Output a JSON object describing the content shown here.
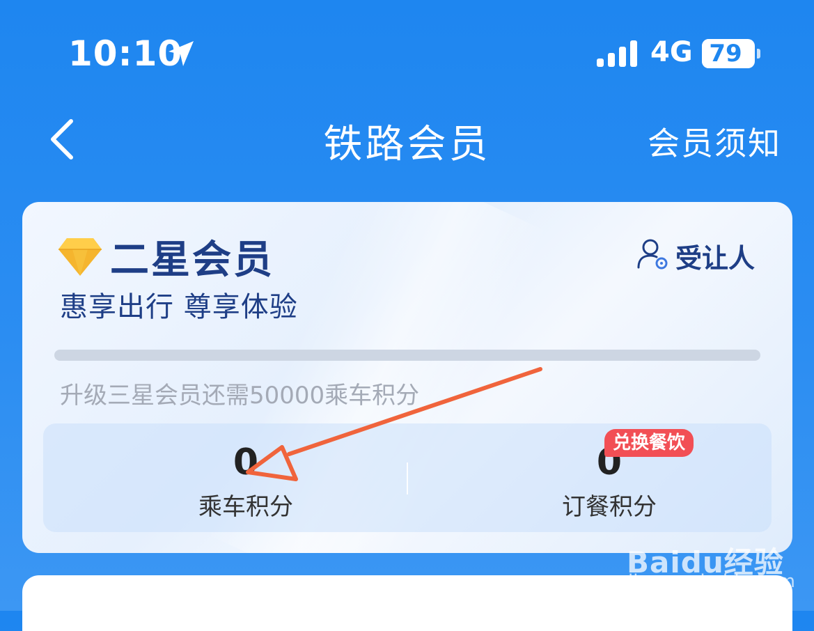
{
  "status_bar": {
    "time": "10:10",
    "network": "4G",
    "battery": "79",
    "battery_level": 0.79
  },
  "header": {
    "title": "铁路会员",
    "notice": "会员须知"
  },
  "membership": {
    "level": "二星会员",
    "slogan": "惠享出行 尊享体验",
    "transferee": "受让人",
    "progress": 0.0,
    "upgrade_hint": "升级三星会员还需50000乘车积分"
  },
  "points": {
    "ride": {
      "value": "0",
      "label": "乘车积分"
    },
    "meal": {
      "value": "0",
      "label": "订餐积分",
      "badge": "兑换餐饮"
    }
  },
  "watermark": {
    "logo": "Baidu经验",
    "url": "jingyan.baidu.com"
  },
  "colors": {
    "header_bg": "#1E86F0",
    "level_text": "#1E3E86",
    "badge": "#F24F55",
    "annotation_arrow": "#F0643C"
  },
  "icons": [
    "location-arrow-icon",
    "signal-icon",
    "battery-icon",
    "back-icon",
    "diamond-icon",
    "person-gear-icon"
  ]
}
